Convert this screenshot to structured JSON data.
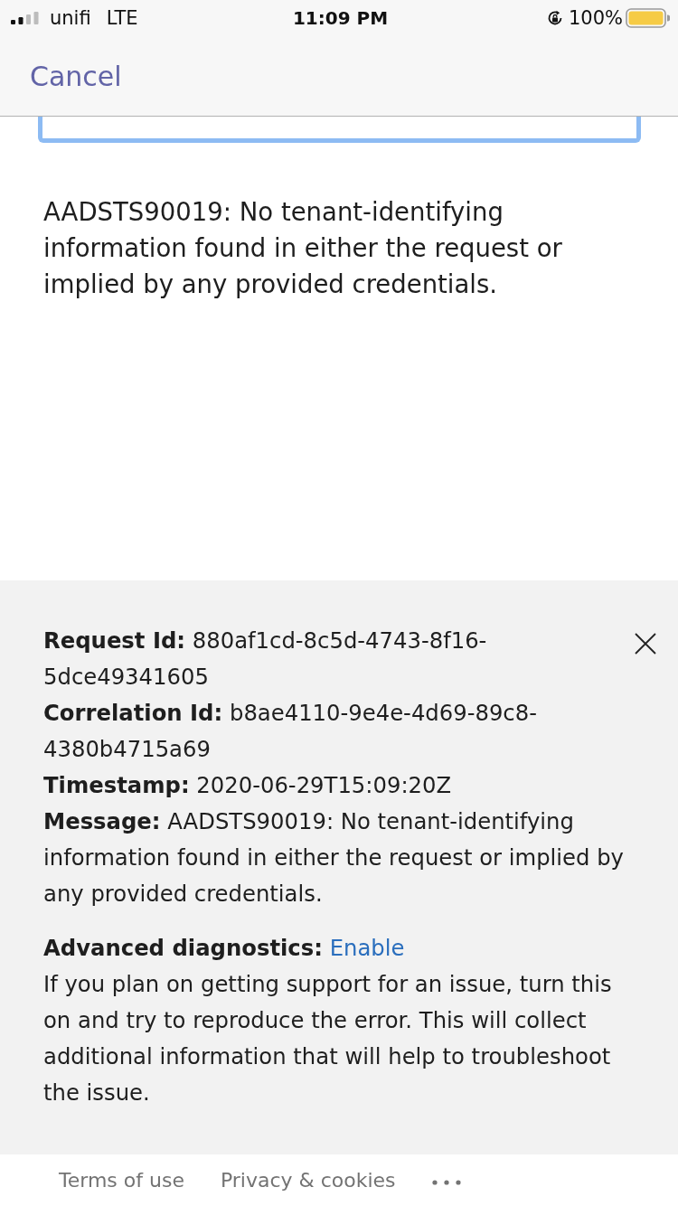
{
  "status_bar": {
    "carrier": "unifi",
    "network": "LTE",
    "time": "11:09 PM",
    "battery": "100%"
  },
  "nav_bar": {
    "cancel": "Cancel"
  },
  "error_text": "AADSTS90019: No tenant-identifying information found in either the request or implied by any provided credentials.",
  "details": {
    "lines": [
      "**Request Id:** 880af1cd-8c5d-4743-8f16-5dce49341605",
      "**Correlation Id:** b8ae4110-9e4e-4d69-89c8-4380b4715a69",
      "**Timestamp:** 2020-06-29T15:09:20Z",
      "**Message:** AADSTS90019: No tenant-identifying information found in either the request or implied by any provided credentials."
    ],
    "diagnostics": {
      "label": "Advanced diagnostics:",
      "link": "Enable",
      "description": "If you plan on getting support for an issue, turn this on and try to reproduce the error. This will collect additional information that will help to troubleshoot the issue."
    }
  },
  "footer": {
    "links": [
      "Terms of use",
      "Privacy & cookies"
    ]
  }
}
